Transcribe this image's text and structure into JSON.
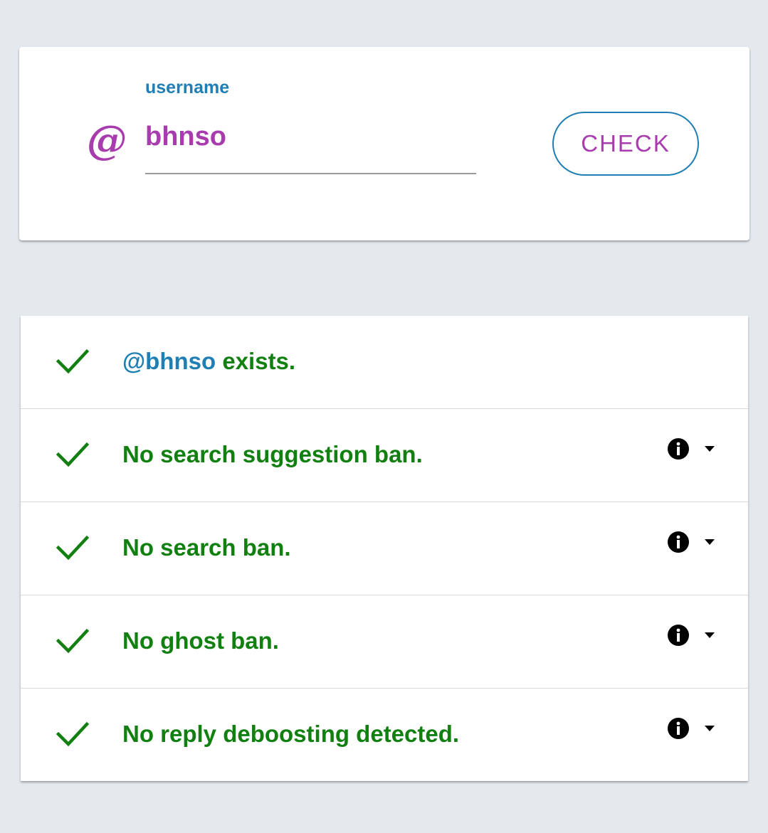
{
  "search": {
    "label": "username",
    "prefix_icon": "at-icon",
    "value": "bhnso",
    "button_label": "CHECK"
  },
  "results": [
    {
      "status": "pass",
      "handle": "@bhnso",
      "text": " exists.",
      "has_info": false
    },
    {
      "status": "pass",
      "text": "No search suggestion ban.",
      "has_info": true
    },
    {
      "status": "pass",
      "text": "No search ban.",
      "has_info": true
    },
    {
      "status": "pass",
      "text": "No ghost ban.",
      "has_info": true
    },
    {
      "status": "pass",
      "text": "No reply deboosting detected.",
      "has_info": true
    }
  ],
  "icons": {
    "status": "check-icon",
    "info": "info-icon",
    "expand": "dropdown-arrow-icon"
  },
  "colors": {
    "background": "#e4e9ee",
    "accent_purple": "#a83bad",
    "accent_blue": "#1f7fb5",
    "success_green": "#118011"
  }
}
